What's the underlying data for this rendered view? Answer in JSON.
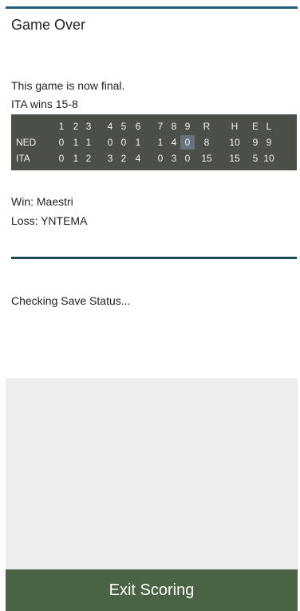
{
  "title": "Game Over",
  "final_text": "This game is now final.",
  "result_text": "ITA wins 15-8",
  "scoreboard": {
    "headers": [
      "1",
      "2",
      "3",
      "4",
      "5",
      "6",
      "7",
      "8",
      "9",
      "R",
      "H",
      "E",
      "L"
    ],
    "rows": [
      {
        "team": "NED",
        "cells": [
          "0",
          "1",
          "1",
          "0",
          "0",
          "1",
          "1",
          "4",
          "0",
          "8",
          "10",
          "9",
          "9"
        ]
      },
      {
        "team": "ITA",
        "cells": [
          "0",
          "1",
          "2",
          "3",
          "2",
          "4",
          "0",
          "3",
          "0",
          "15",
          "15",
          "5",
          "10"
        ]
      }
    ],
    "highlighted_cell": {
      "row": 0,
      "col": 8
    }
  },
  "win_text": "Win: Maestri",
  "loss_text": "Loss: YNTEMA",
  "save_status": "Checking Save Status...",
  "exit_button_label": "Exit Scoring",
  "colors": {
    "accent_rule": "#1e5e7a",
    "scoreboard_bg": "#4a4f48",
    "button_bg": "#496344"
  }
}
